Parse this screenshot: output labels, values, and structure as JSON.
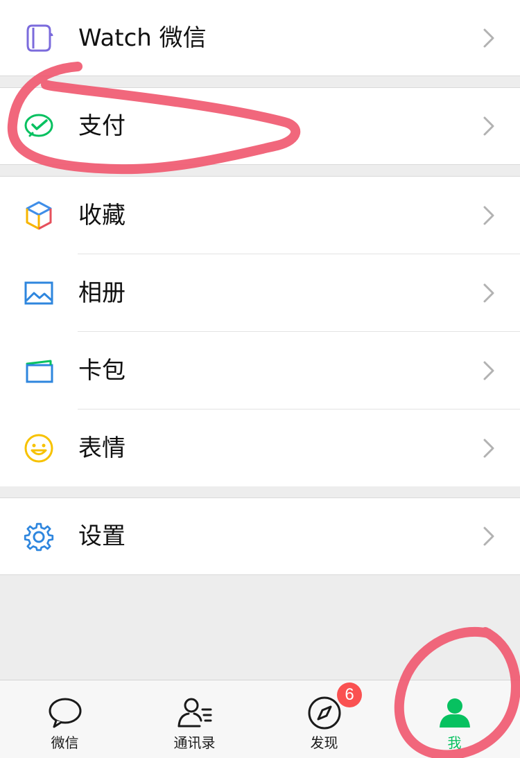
{
  "menu": {
    "watch": {
      "label": "Watch 微信",
      "icon": "watch-icon"
    },
    "pay": {
      "label": "支付",
      "icon": "wechat-pay-icon"
    },
    "favorites": {
      "label": "收藏",
      "icon": "cube-icon"
    },
    "album": {
      "label": "相册",
      "icon": "picture-icon"
    },
    "cards": {
      "label": "卡包",
      "icon": "card-wallet-icon"
    },
    "stickers": {
      "label": "表情",
      "icon": "smiley-icon"
    },
    "settings": {
      "label": "设置",
      "icon": "gear-icon"
    }
  },
  "tabbar": {
    "tabs": [
      {
        "label": "微信",
        "icon": "chat-bubble-icon",
        "active": false
      },
      {
        "label": "通讯录",
        "icon": "contacts-icon",
        "active": false
      },
      {
        "label": "发现",
        "icon": "compass-icon",
        "active": false,
        "badge": "6"
      },
      {
        "label": "我",
        "icon": "person-icon",
        "active": true
      }
    ]
  },
  "colors": {
    "accent": "#07c160",
    "badge": "#fa5151",
    "annotation": "#f0566e",
    "background": "#ededed"
  }
}
